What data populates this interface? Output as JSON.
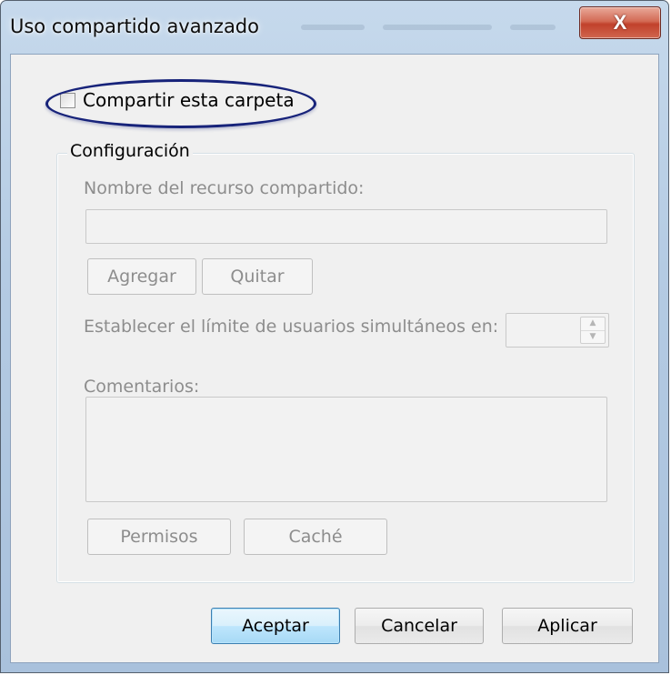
{
  "dialog": {
    "title": "Uso compartido avanzado",
    "close_label": "X"
  },
  "share": {
    "checkbox_label": "Compartir esta carpeta",
    "checked": false
  },
  "settings": {
    "group_label": "Configuración",
    "share_name_label": "Nombre del recurso compartido:",
    "share_name_value": "",
    "add_button": "Agregar",
    "remove_button": "Quitar",
    "user_limit_label": "Establecer el límite de usuarios simultáneos en:",
    "user_limit_value": "",
    "comments_label": "Comentarios:",
    "comments_value": "",
    "permissions_button": "Permisos",
    "cache_button": "Caché"
  },
  "footer": {
    "ok_button": "Aceptar",
    "cancel_button": "Cancelar",
    "apply_button": "Aplicar"
  },
  "icons": {
    "close": "close-icon",
    "spin_up": "spin-up-icon",
    "spin_down": "spin-down-icon"
  }
}
